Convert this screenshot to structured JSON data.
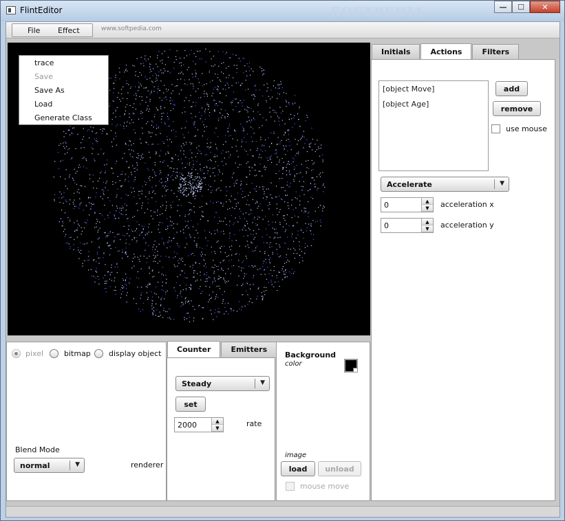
{
  "window": {
    "title": "FlintEditor",
    "watermark": "SOFTPEDIA",
    "minimize_glyph": "—",
    "maximize_glyph": "☐",
    "close_glyph": "✕"
  },
  "menubar": {
    "file_label": "File",
    "effect_label": "Effect",
    "watermark": "SOFTPEDIA",
    "watermark_url": "www.softpedia.com"
  },
  "file_menu": {
    "items": [
      {
        "label": "trace",
        "enabled": true
      },
      {
        "label": "Save",
        "enabled": false
      },
      {
        "label": "Save As",
        "enabled": true
      },
      {
        "label": "Load",
        "enabled": true
      },
      {
        "label": "Generate Class",
        "enabled": true
      }
    ]
  },
  "renderer_panel": {
    "radio_options": [
      {
        "label": "pixel",
        "checked": true,
        "enabled": false
      },
      {
        "label": "bitmap",
        "checked": false,
        "enabled": true
      },
      {
        "label": "display object",
        "checked": false,
        "enabled": true
      }
    ],
    "blend_mode_label": "Blend Mode",
    "blend_mode_value": "normal",
    "renderer_label": "renderer"
  },
  "counter_panel": {
    "tabs": [
      "Counter",
      "Emitters"
    ],
    "active_tab": "Counter",
    "counter_type": "Steady",
    "set_label": "set",
    "rate_value": "2000",
    "rate_label": "rate"
  },
  "background_panel": {
    "title": "Background",
    "color_label": "color",
    "color_value": "#000000",
    "image_label": "image",
    "load_label": "load",
    "unload_label": "unload",
    "mouse_move_label": "mouse move"
  },
  "right_panel": {
    "tabs": [
      "Initials",
      "Actions",
      "Filters"
    ],
    "active_tab": "Actions",
    "actions_list": [
      "[object Move]",
      "[object Age]"
    ],
    "add_label": "add",
    "remove_label": "remove",
    "use_mouse_label": "use mouse",
    "action_type": "Accelerate",
    "accel_x_value": "0",
    "accel_x_label": "acceleration x",
    "accel_y_value": "0",
    "accel_y_label": "acceleration y"
  },
  "colors": {
    "canvas_bg": "#000000",
    "particle": "#c8d0ff",
    "particle_core": "#4a5cff"
  }
}
